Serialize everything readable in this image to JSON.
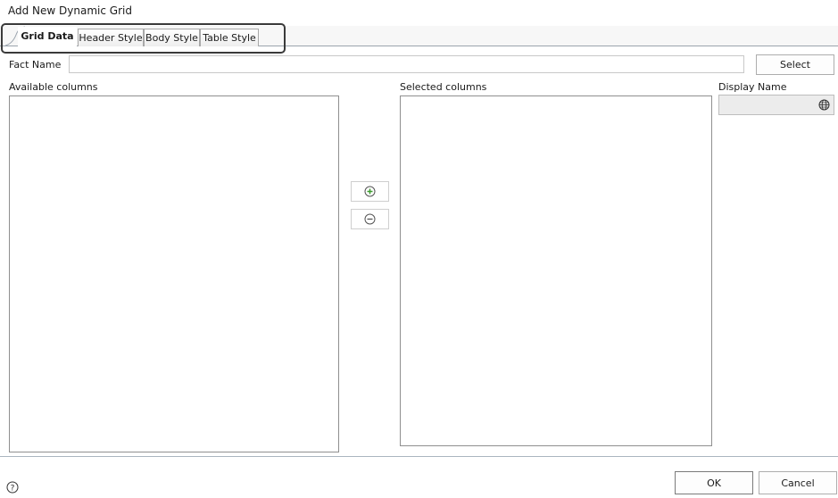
{
  "dialog": {
    "title": "Add New Dynamic Grid"
  },
  "tabs": [
    {
      "label": "Grid Data",
      "active": true
    },
    {
      "label": "Header Style",
      "active": false
    },
    {
      "label": "Body Style",
      "active": false
    },
    {
      "label": "Table Style",
      "active": false
    }
  ],
  "fact": {
    "label": "Fact Name",
    "value": "",
    "select_label": "Select"
  },
  "available": {
    "label": "Available columns",
    "items": []
  },
  "selected": {
    "label": "Selected columns",
    "items": []
  },
  "display_name": {
    "label": "Display Name",
    "value": "",
    "icon": "globe-icon"
  },
  "move": {
    "add_icon": "plus-circle-icon",
    "remove_icon": "minus-circle-icon"
  },
  "footer": {
    "ok_label": "OK",
    "cancel_label": "Cancel",
    "help_icon": "help-circle-icon"
  },
  "colors": {
    "tab_highlight": "#3a3a3a",
    "add_green": "#3d9b2f",
    "separator": "#aab5c0"
  }
}
